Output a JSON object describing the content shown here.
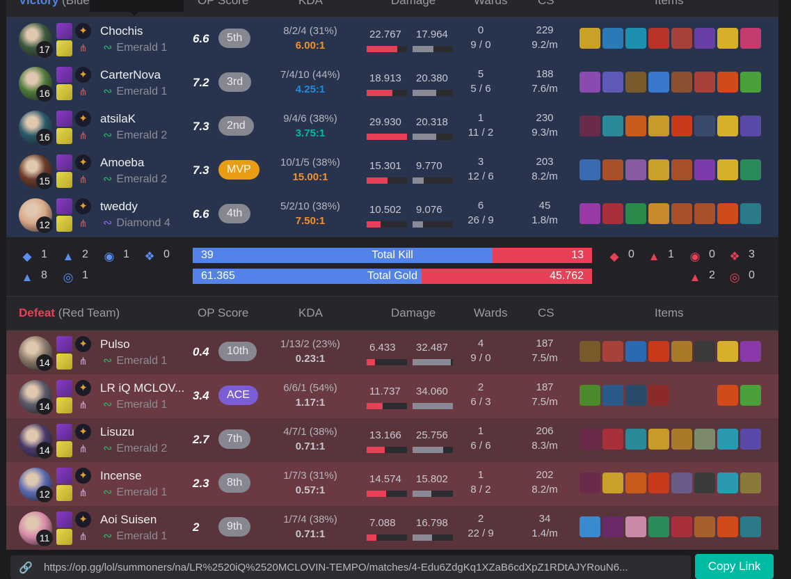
{
  "colors": {
    "blue": "#5383e8",
    "red": "#e84057",
    "teal": "#00bba3",
    "mvp": "#e89d14",
    "ace": "#7b5dd6"
  },
  "columns": {
    "op_score": "OP Score",
    "kda": "KDA",
    "damage": "Damage",
    "wards": "Wards",
    "cs": "CS",
    "items": "Items"
  },
  "blue_team": {
    "result": "Victory",
    "label": "(Blue Team)",
    "players": [
      {
        "name": "Chochis",
        "level": "17",
        "rank": "Emerald 1",
        "rank_icon": "emerald-wings-icon",
        "score": "6.6",
        "badge": "5th",
        "kda": "8/2/4 (31%)",
        "ratio": "6.00:1",
        "ratio_color": "#f2922e",
        "dmg_dealt": "22.767",
        "dmg_taken": "17.964",
        "dealt_frac": 0.76,
        "taken_frac": 0.52,
        "wards": "0",
        "wards_detail": "9 / 0",
        "cs": "229",
        "cs_pm": "9.2/m",
        "avatar": "#3c5a3e",
        "items": [
          "#c9a227",
          "#2b7ab8",
          "#1d8fb0",
          "#b8342a",
          "#a8413a",
          "#6a3fa5",
          "#d7b02a",
          "#c43b6d"
        ]
      },
      {
        "name": "CarterNova",
        "level": "16",
        "rank": "Emerald 1",
        "rank_icon": "emerald-wings-icon",
        "score": "7.2",
        "badge": "3rd",
        "kda": "7/4/10 (44%)",
        "ratio": "4.25:1",
        "ratio_color": "#1f8ce0",
        "dmg_dealt": "18.913",
        "dmg_taken": "20.380",
        "dealt_frac": 0.63,
        "taken_frac": 0.59,
        "wards": "5",
        "wards_detail": "5 / 6",
        "cs": "188",
        "cs_pm": "7.6/m",
        "avatar": "#4e7a3a",
        "items": [
          "#8a4ab0",
          "#5f5ab8",
          "#7a5a2a",
          "#3a78d0",
          "#8a5030",
          "#a8413a",
          "#d04a1a",
          "#4aa03a"
        ]
      },
      {
        "name": "atsilaK",
        "level": "16",
        "rank": "Emerald 2",
        "rank_icon": "emerald-wings-icon",
        "score": "7.3",
        "badge": "2nd",
        "kda": "9/4/6 (38%)",
        "ratio": "3.75:1",
        "ratio_color": "#00bba3",
        "dmg_dealt": "29.930",
        "dmg_taken": "20.318",
        "dealt_frac": 1.0,
        "taken_frac": 0.59,
        "wards": "1",
        "wards_detail": "11 / 2",
        "cs": "230",
        "cs_pm": "9.3/m",
        "avatar": "#2a5a6a",
        "items": [
          "#6a2a4a",
          "#2a8a9a",
          "#c85a1a",
          "#c89a2a",
          "#c83a1a",
          "#3a4a6a",
          "#d7b02a",
          "#5a4aa8"
        ]
      },
      {
        "name": "Amoeba",
        "level": "15",
        "rank": "Emerald 2",
        "rank_icon": "emerald-wings-icon",
        "score": "7.3",
        "badge": "MVP",
        "kda": "10/1/5 (38%)",
        "ratio": "15.00:1",
        "ratio_color": "#f2922e",
        "dmg_dealt": "15.301",
        "dmg_taken": "9.770",
        "dealt_frac": 0.51,
        "taken_frac": 0.28,
        "wards": "3",
        "wards_detail": "12 / 6",
        "cs": "203",
        "cs_pm": "8.2/m",
        "avatar": "#6a3a2a",
        "items": [
          "#3a6ab0",
          "#a8502a",
          "#8a5aa0",
          "#c8a02a",
          "#a8502a",
          "#7a3aa8",
          "#d7b02a",
          "#2a8a5a"
        ]
      },
      {
        "name": "tweddy",
        "level": "12",
        "rank": "Diamond 4",
        "rank_icon": "diamond-wings-icon",
        "score": "6.6",
        "badge": "4th",
        "kda": "5/2/10 (38%)",
        "ratio": "7.50:1",
        "ratio_color": "#f2922e",
        "dmg_dealt": "10.502",
        "dmg_taken": "9.076",
        "dealt_frac": 0.35,
        "taken_frac": 0.26,
        "wards": "6",
        "wards_detail": "26 / 9",
        "cs": "45",
        "cs_pm": "1.8/m",
        "avatar": "#d8a888",
        "items": [
          "#9a3aa8",
          "#a8303a",
          "#2a8a4a",
          "#c88a2a",
          "#a8502a",
          "#a8502a",
          "#d04a1a",
          "#2a7a8a"
        ]
      }
    ]
  },
  "summary": {
    "blue_objectives": [
      {
        "icon": "baron-icon",
        "value": "1"
      },
      {
        "icon": "dragon-icon",
        "value": "2"
      },
      {
        "icon": "herald-icon",
        "value": "1"
      },
      {
        "icon": "tower-icon",
        "value": "0"
      },
      {
        "icon": "inhibitor-icon",
        "value": "8"
      },
      {
        "icon": "grub-icon",
        "value": "1"
      }
    ],
    "red_objectives": [
      {
        "icon": "baron-icon",
        "value": "0"
      },
      {
        "icon": "dragon-icon",
        "value": "1"
      },
      {
        "icon": "herald-icon",
        "value": "0"
      },
      {
        "icon": "tower-icon",
        "value": "3"
      },
      {
        "icon": "inhibitor-icon",
        "value": "2"
      },
      {
        "icon": "grub-icon",
        "value": "0"
      }
    ],
    "kills": {
      "label": "Total Kill",
      "blue": "39",
      "red": "13",
      "blue_frac": 0.75
    },
    "gold": {
      "label": "Total Gold",
      "blue": "61.365",
      "red": "45.762",
      "blue_frac": 0.573
    }
  },
  "red_team": {
    "result": "Defeat",
    "label": "(Red Team)",
    "players": [
      {
        "name": "Pulso",
        "level": "14",
        "rank": "Emerald 1",
        "rank_icon": "emerald-wings-icon",
        "score": "0.4",
        "badge": "10th",
        "kda": "1/13/2 (23%)",
        "ratio": "0.23:1",
        "ratio_color": "#c8c8d0",
        "dmg_dealt": "6.433",
        "dmg_taken": "32.487",
        "dealt_frac": 0.2,
        "taken_frac": 0.95,
        "wards": "4",
        "wards_detail": "9 / 0",
        "cs": "187",
        "cs_pm": "7.5/m",
        "avatar": "#8a7a6a",
        "items": [
          "#7a5a2a",
          "#a8413a",
          "#2a6ab0",
          "#c83a1a",
          "#a87a2a",
          "#3a3a3a",
          "#d7b02a",
          "#8a3aa8"
        ]
      },
      {
        "name": "LR iQ MCLOV...",
        "level": "14",
        "rank": "Emerald 1",
        "rank_icon": "emerald-wings-icon",
        "score": "3.4",
        "badge": "ACE",
        "kda": "6/6/1 (54%)",
        "ratio": "1.17:1",
        "ratio_color": "#c8c8d0",
        "dmg_dealt": "11.737",
        "dmg_taken": "34.060",
        "dealt_frac": 0.39,
        "taken_frac": 1.0,
        "wards": "2",
        "wards_detail": "6 / 3",
        "cs": "187",
        "cs_pm": "7.5/m",
        "avatar": "#5a5a6a",
        "items": [
          "#4a8a2a",
          "#2a5a8a",
          "#2a4a6a",
          "#8a2a2a",
          "",
          "",
          "#d04a1a",
          "#4aa03a"
        ]
      },
      {
        "name": "Lisuzu",
        "level": "14",
        "rank": "Emerald 2",
        "rank_icon": "emerald-wings-icon",
        "score": "2.7",
        "badge": "7th",
        "kda": "4/7/1 (38%)",
        "ratio": "0.71:1",
        "ratio_color": "#c8c8d0",
        "dmg_dealt": "13.166",
        "dmg_taken": "25.756",
        "dealt_frac": 0.44,
        "taken_frac": 0.76,
        "wards": "1",
        "wards_detail": "6 / 6",
        "cs": "206",
        "cs_pm": "8.3/m",
        "avatar": "#4a3a6a",
        "items": [
          "#6a2a4a",
          "#a8303a",
          "#2a8a9a",
          "#c89a2a",
          "#a87a2a",
          "#7a8a6a",
          "#2a9ab0",
          "#5a4aa8"
        ]
      },
      {
        "name": "Incense",
        "level": "12",
        "rank": "Emerald 1",
        "rank_icon": "emerald-wings-icon",
        "score": "2.3",
        "badge": "8th",
        "kda": "1/7/3 (31%)",
        "ratio": "0.57:1",
        "ratio_color": "#c8c8d0",
        "dmg_dealt": "14.574",
        "dmg_taken": "15.802",
        "dealt_frac": 0.49,
        "taken_frac": 0.46,
        "wards": "1",
        "wards_detail": "8 / 2",
        "cs": "202",
        "cs_pm": "8.2/m",
        "avatar": "#5a6ab0",
        "items": [
          "#6a2a4a",
          "#c8a02a",
          "#c85a1a",
          "#c83a1a",
          "#6a5a8a",
          "#3a3a3a",
          "#2a9ab0",
          "#8a7a3a"
        ]
      },
      {
        "name": "Aoi Suisen",
        "level": "11",
        "rank": "Emerald 1",
        "rank_icon": "emerald-wings-icon",
        "score": "2",
        "badge": "9th",
        "kda": "1/7/4 (38%)",
        "ratio": "0.71:1",
        "ratio_color": "#c8c8d0",
        "dmg_dealt": "7.088",
        "dmg_taken": "16.798",
        "dealt_frac": 0.24,
        "taken_frac": 0.49,
        "wards": "2",
        "wards_detail": "22 / 9",
        "cs": "34",
        "cs_pm": "1.4/m",
        "avatar": "#d88aa8",
        "items": [
          "#3a8ad0",
          "#6a2a6a",
          "#c88aa8",
          "#2a8a5a",
          "#a8303a",
          "#a8602a",
          "#d04a1a",
          "#2a7a8a"
        ]
      }
    ]
  },
  "share": {
    "url": "https://op.gg/lol/summoners/na/LR%2520iQ%2520MCLOVIN-TEMPO/matches/4-Edu6ZdgKq1XZaB6cdXpZ1RDtAJYRouN6...",
    "copy_label": "Copy Link",
    "link_icon": "link-icon"
  }
}
